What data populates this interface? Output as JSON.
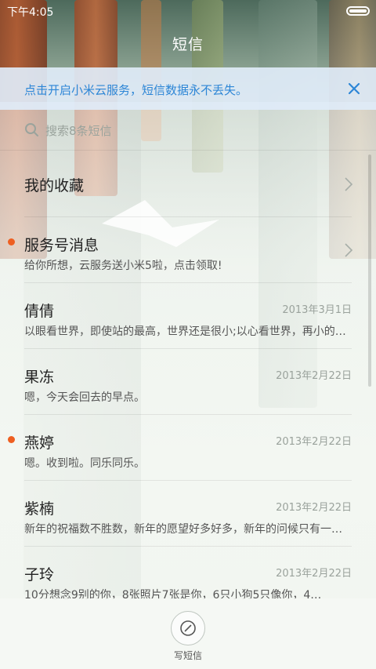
{
  "status_bar": {
    "time": "下午4:05"
  },
  "header": {
    "title": "短信"
  },
  "banner": {
    "text": "点击开启小米云服务，短信数据永不丢失。",
    "accent_color": "#2d86d6",
    "close_icon": "close-icon"
  },
  "search": {
    "placeholder": "搜索8条短信",
    "icon": "search-icon"
  },
  "conversations": [
    {
      "name": "我的收藏",
      "preview": "",
      "date": "",
      "unread": false,
      "chevron": true
    },
    {
      "name": "服务号消息",
      "preview": "给你所想，云服务送小米5啦，点击领取!",
      "date": "",
      "unread": true,
      "chevron": true
    },
    {
      "name": "倩倩",
      "preview": "以眼看世界，即使站的最高，世界还是很小;以心看世界，再小的世界都…",
      "date": "2013年3月1日",
      "unread": false,
      "chevron": false
    },
    {
      "name": "果冻",
      "preview": "嗯，今天会回去的早点。",
      "date": "2013年2月22日",
      "unread": false,
      "chevron": false
    },
    {
      "name": "燕婷",
      "preview": "嗯。收到啦。同乐同乐。",
      "date": "2013年2月22日",
      "unread": true,
      "chevron": false
    },
    {
      "name": "紫楠",
      "preview": "新年的祝福数不胜数，新年的愿望好多好多，新年的问候只有一句…",
      "date": "2013年2月22日",
      "unread": false,
      "chevron": false
    },
    {
      "name": "子玲",
      "preview": "10分想念9别的你，8张照片7张是你，6只小狗5只像你，4…",
      "date": "2013年2月22日",
      "unread": false,
      "chevron": false
    }
  ],
  "compose": {
    "label": "写短信",
    "icon": "compose-icon"
  },
  "colors": {
    "unread_dot": "#ee5f21",
    "title_text": "#ffffff"
  }
}
